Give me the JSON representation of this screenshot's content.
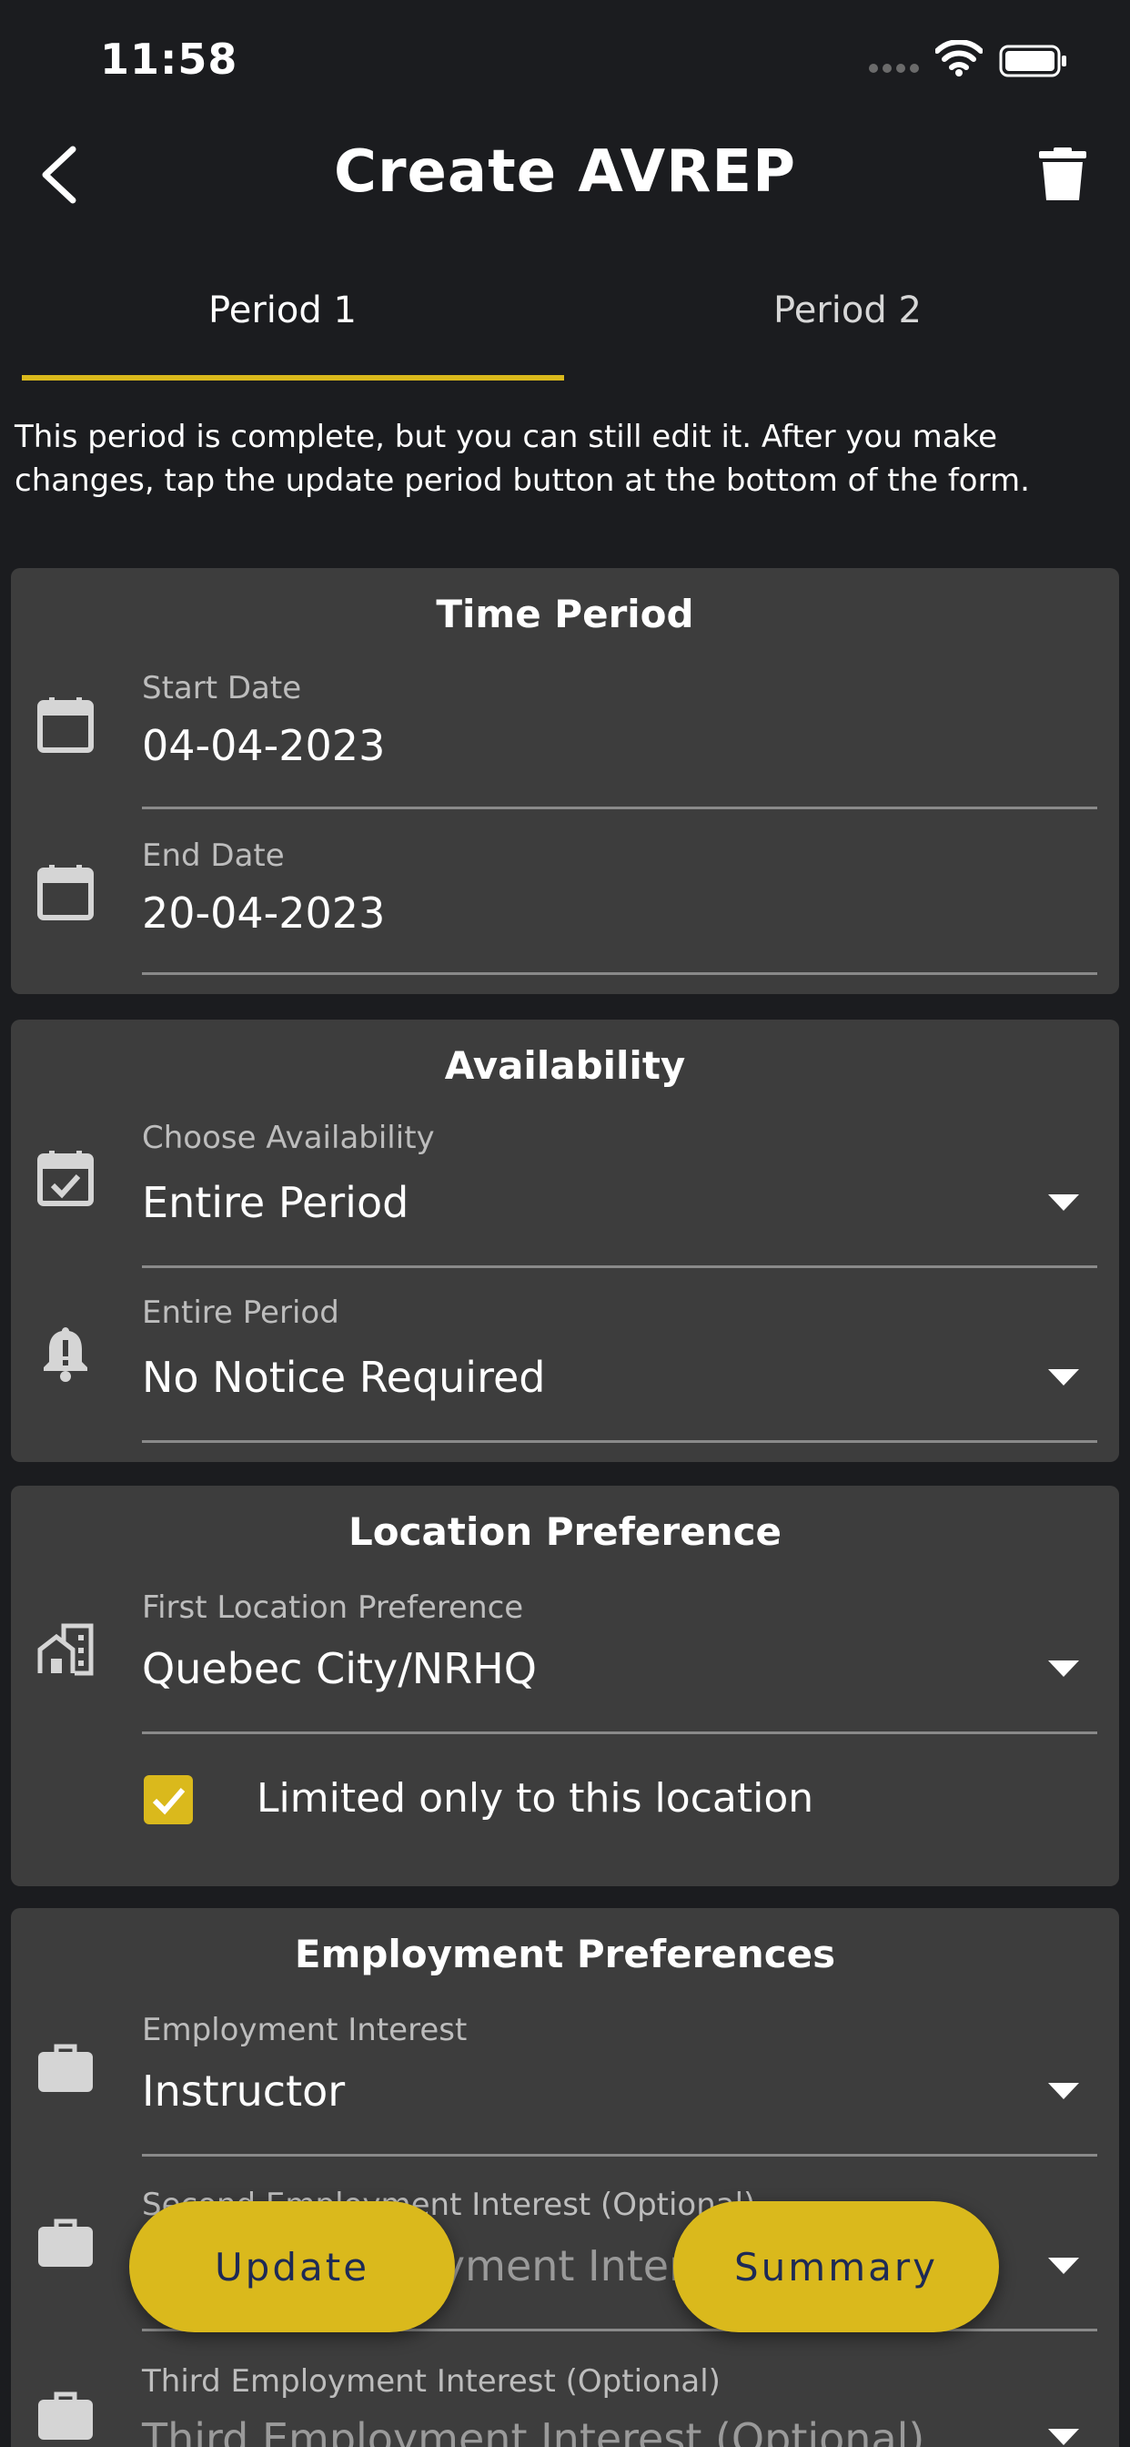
{
  "status_bar": {
    "time": "11:58"
  },
  "header": {
    "title": "Create AVREP"
  },
  "tabs": [
    {
      "label": "Period 1",
      "active": true
    },
    {
      "label": "Period 2",
      "active": false
    }
  ],
  "notice": "This period is complete, but you can still edit it. After you make changes, tap the update period button at the bottom of the form.",
  "time_period": {
    "title": "Time Period",
    "start_label": "Start Date",
    "start_value": "04-04-2023",
    "end_label": "End Date",
    "end_value": "20-04-2023"
  },
  "availability": {
    "title": "Availability",
    "choose_label": "Choose Availability",
    "choose_value": "Entire Period",
    "notice_label": "Entire Period",
    "notice_value": "No Notice Required"
  },
  "location": {
    "title": "Location Preference",
    "first_label": "First Location Preference",
    "first_value": "Quebec City/NRHQ",
    "limited_label": "Limited only to this location",
    "limited_checked": true
  },
  "employment": {
    "title": "Employment Preferences",
    "first_label": "Employment Interest",
    "first_value": "Instructor",
    "second_label": "Second Employment Interest (Optional)",
    "second_value": "Second Employment Interest (Optional)",
    "third_label": "Third Employment Interest (Optional)",
    "third_value": "Third Employment Interest (Optional)"
  },
  "actions": {
    "update_label": "Update",
    "summary_label": "Summary"
  },
  "colors": {
    "accent": "#dab91c",
    "card": "#3d3d3d",
    "background": "#1b1c1f",
    "button_text": "#1e2a55"
  },
  "icons": [
    "back-icon",
    "trash-icon",
    "calendar-icon",
    "event-available-icon",
    "bell-alert-icon",
    "location-city-icon",
    "briefcase-icon",
    "caret-down-icon",
    "check-icon"
  ]
}
